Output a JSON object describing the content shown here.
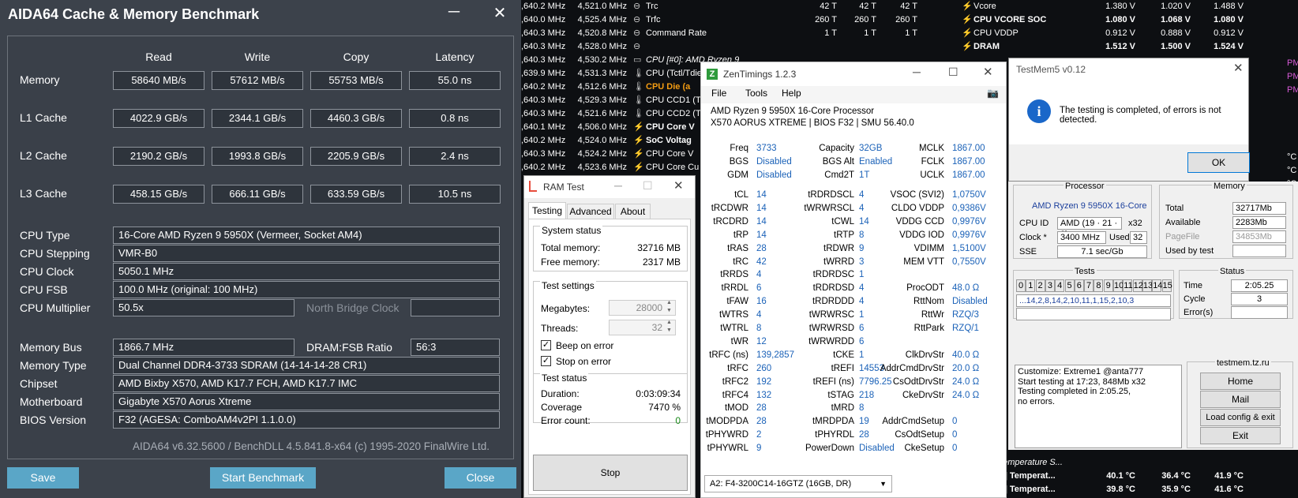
{
  "aida": {
    "title": "AIDA64 Cache & Memory Benchmark",
    "minimize": "─",
    "close": "✕",
    "headers": [
      "Read",
      "Write",
      "Copy",
      "Latency"
    ],
    "bench_rows": [
      {
        "label": "Memory",
        "read": "58640 MB/s",
        "write": "57612 MB/s",
        "copy": "55753 MB/s",
        "latency": "55.0 ns"
      },
      {
        "label": "L1 Cache",
        "read": "4022.9 GB/s",
        "write": "2344.1 GB/s",
        "copy": "4460.3 GB/s",
        "latency": "0.8 ns"
      },
      {
        "label": "L2 Cache",
        "read": "2190.2 GB/s",
        "write": "1993.8 GB/s",
        "copy": "2205.9 GB/s",
        "latency": "2.4 ns"
      },
      {
        "label": "L3 Cache",
        "read": "458.15 GB/s",
        "write": "666.11 GB/s",
        "copy": "633.59 GB/s",
        "latency": "10.5 ns"
      }
    ],
    "cpu_type_label": "CPU Type",
    "cpu_type": "16-Core AMD Ryzen 9 5950X  (Vermeer, Socket AM4)",
    "cpu_stepping_label": "CPU Stepping",
    "cpu_stepping": "VMR-B0",
    "cpu_clock_label": "CPU Clock",
    "cpu_clock": "5050.1 MHz",
    "cpu_fsb_label": "CPU FSB",
    "cpu_fsb": "100.0 MHz  (original: 100 MHz)",
    "cpu_mult_label": "CPU Multiplier",
    "cpu_mult": "50.5x",
    "nb_clock_label": "North Bridge Clock",
    "nb_clock": "",
    "mem_bus_label": "Memory Bus",
    "mem_bus": "1866.7 MHz",
    "dram_ratio_label": "DRAM:FSB Ratio",
    "dram_ratio": "56:3",
    "mem_type_label": "Memory Type",
    "mem_type": "Dual Channel DDR4-3733 SDRAM  (14-14-14-28 CR1)",
    "chipset_label": "Chipset",
    "chipset": "AMD Bixby X570, AMD K17.7 FCH, AMD K17.7 IMC",
    "mobo_label": "Motherboard",
    "mobo": "Gigabyte X570 Aorus Xtreme",
    "bios_label": "BIOS Version",
    "bios": "F32  (AGESA: ComboAM4v2PI 1.1.0.0)",
    "footer": "AIDA64 v6.32.5600 / BenchDLL 4.5.841.8-x64  (c) 1995-2020 FinalWire Ltd.",
    "save": "Save",
    "start": "Start Benchmark",
    "close_btn": "Close"
  },
  "hw_left": [
    ",640.2 MHz",
    "4,521.0 MHz",
    ",640.0 MHz",
    "4,525.4 MHz",
    ",640.3 MHz",
    "4,520.8 MHz",
    ",640.3 MHz",
    "4,528.0 MHz",
    ",640.3 MHz",
    "4,530.2 MHz",
    ",639.9 MHz",
    "4,531.3 MHz",
    ",640.2 MHz",
    "4,512.6 MHz",
    ",640.3 MHz",
    "4,529.3 MHz",
    ",640.3 MHz",
    "4,521.6 MHz",
    ",640.1 MHz",
    "4,506.0 MHz",
    ",640.2 MHz",
    "4,524.0 MHz",
    ",640.3 MHz",
    "4,524.2 MHz",
    ",640.2 MHz",
    "4,523.6 MHz"
  ],
  "hw_mid": [
    {
      "name": "Trc",
      "a": "42 T",
      "b": "42 T",
      "c": "42 T"
    },
    {
      "name": "Trfc",
      "a": "260 T",
      "b": "260 T",
      "c": "260 T"
    },
    {
      "name": "Command Rate",
      "a": "1 T",
      "b": "1 T",
      "c": "1 T"
    },
    {
      "name": "",
      "a": "",
      "b": "",
      "c": ""
    },
    {
      "name": "CPU [#0]: AMD Ryzen 9",
      "a": "",
      "b": "",
      "c": ""
    },
    {
      "name": "CPU (Tctl/Tdie)",
      "a": "",
      "b": "",
      "c": ""
    },
    {
      "name": "CPU Die (a",
      "a": "",
      "b": "",
      "c": ""
    },
    {
      "name": "CPU CCD1 (T",
      "a": "",
      "b": "",
      "c": ""
    },
    {
      "name": "CPU CCD2 (T",
      "a": "",
      "b": "",
      "c": ""
    },
    {
      "name": "CPU Core V",
      "a": "",
      "b": "",
      "c": ""
    },
    {
      "name": "SoC Voltag",
      "a": "",
      "b": "",
      "c": ""
    },
    {
      "name": "CPU Core V",
      "a": "",
      "b": "",
      "c": ""
    },
    {
      "name": "CPU Core Cu",
      "a": "",
      "b": "",
      "c": ""
    }
  ],
  "hw_right": [
    {
      "name": "Vcore",
      "a": "1.380 V",
      "b": "1.020 V",
      "c": "1.488 V",
      "bold": false
    },
    {
      "name": "CPU VCORE SOC",
      "a": "1.080 V",
      "b": "1.068 V",
      "c": "1.080 V",
      "bold": true
    },
    {
      "name": "CPU VDDP",
      "a": "0.912 V",
      "b": "0.888 V",
      "c": "0.912 V",
      "bold": false
    },
    {
      "name": "DRAM",
      "a": "1.512 V",
      "b": "1.500 V",
      "c": "1.524 V",
      "bold": true
    }
  ],
  "hw_right_edge": [
    "PM",
    "PM",
    "PM",
    "",
    "",
    "",
    "",
    "°C",
    "°C",
    "°C"
  ],
  "hw_dimm": {
    "header": "DIMM Temperature S...",
    "rows": [
      {
        "name": "DIMM[2] Temperat...",
        "a": "40.1 °C",
        "b": "36.4 °C",
        "c": "41.9 °C"
      },
      {
        "name": "DIMM[3] Temperat...",
        "a": "39.8 °C",
        "b": "35.9 °C",
        "c": "41.6 °C"
      }
    ]
  },
  "zen": {
    "title": "ZenTimings 1.2.3",
    "menu": [
      "File",
      "Tools",
      "Help"
    ],
    "cpu": "AMD Ryzen 9 5950X 16-Core Processor",
    "board": "X570 AORUS XTREME | BIOS F32 | SMU 56.40.0",
    "top": [
      {
        "l1": "Freq",
        "v1": "3733",
        "l2": "Capacity",
        "v2": "32GB",
        "l3": "MCLK",
        "v3": "1867.00"
      },
      {
        "l1": "BGS",
        "v1": "Disabled",
        "l2": "BGS Alt",
        "v2": "Enabled",
        "l3": "FCLK",
        "v3": "1867.00"
      },
      {
        "l1": "GDM",
        "v1": "Disabled",
        "l2": "Cmd2T",
        "v2": "1T",
        "l3": "UCLK",
        "v3": "1867.00"
      }
    ],
    "rows": [
      {
        "l1": "tCL",
        "v1": "14",
        "l2": "tRDRDSCL",
        "v2": "4",
        "l3": "VSOC (SVI2)",
        "v3": "1,0750V"
      },
      {
        "l1": "tRCDWR",
        "v1": "14",
        "l2": "tWRWRSCL",
        "v2": "4",
        "l3": "CLDO VDDP",
        "v3": "0,9386V"
      },
      {
        "l1": "tRCDRD",
        "v1": "14",
        "l2": "tCWL",
        "v2": "14",
        "l3": "VDDG CCD",
        "v3": "0,9976V"
      },
      {
        "l1": "tRP",
        "v1": "14",
        "l2": "tRTP",
        "v2": "8",
        "l3": "VDDG IOD",
        "v3": "0,9976V"
      },
      {
        "l1": "tRAS",
        "v1": "28",
        "l2": "tRDWR",
        "v2": "9",
        "l3": "VDIMM",
        "v3": "1,5100V"
      },
      {
        "l1": "tRC",
        "v1": "42",
        "l2": "tWRRD",
        "v2": "3",
        "l3": "MEM VTT",
        "v3": "0,7550V"
      },
      {
        "l1": "tRRDS",
        "v1": "4",
        "l2": "tRDRDSC",
        "v2": "1",
        "l3": "",
        "v3": ""
      },
      {
        "l1": "tRRDL",
        "v1": "6",
        "l2": "tRDRDSD",
        "v2": "4",
        "l3": "ProcODT",
        "v3": "48.0 Ω"
      },
      {
        "l1": "tFAW",
        "v1": "16",
        "l2": "tRDRDDD",
        "v2": "4",
        "l3": "RttNom",
        "v3": "Disabled"
      },
      {
        "l1": "tWTRS",
        "v1": "4",
        "l2": "tWRWRSC",
        "v2": "1",
        "l3": "RttWr",
        "v3": "RZQ/3"
      },
      {
        "l1": "tWTRL",
        "v1": "8",
        "l2": "tWRWRSD",
        "v2": "6",
        "l3": "RttPark",
        "v3": "RZQ/1"
      },
      {
        "l1": "tWR",
        "v1": "12",
        "l2": "tWRWRDD",
        "v2": "6",
        "l3": "",
        "v3": ""
      },
      {
        "l1": "tRFC (ns)",
        "v1": "139,2857",
        "l2": "tCKE",
        "v2": "1",
        "l3": "ClkDrvStr",
        "v3": "40.0 Ω"
      },
      {
        "l1": "tRFC",
        "v1": "260",
        "l2": "tREFI",
        "v2": "14553",
        "l3": "AddrCmdDrvStr",
        "v3": "20.0 Ω"
      },
      {
        "l1": "tRFC2",
        "v1": "192",
        "l2": "tREFI (ns)",
        "v2": "7796.25",
        "l3": "CsOdtDrvStr",
        "v3": "24.0 Ω"
      },
      {
        "l1": "tRFC4",
        "v1": "132",
        "l2": "tSTAG",
        "v2": "218",
        "l3": "CkeDrvStr",
        "v3": "24.0 Ω"
      },
      {
        "l1": "tMOD",
        "v1": "28",
        "l2": "tMRD",
        "v2": "8",
        "l3": "",
        "v3": ""
      },
      {
        "l1": "tMODPDA",
        "v1": "28",
        "l2": "tMRDPDA",
        "v2": "19",
        "l3": "AddrCmdSetup",
        "v3": "0"
      },
      {
        "l1": "tPHYWRD",
        "v1": "2",
        "l2": "tPHYRDL",
        "v2": "28",
        "l3": "CsOdtSetup",
        "v3": "0"
      },
      {
        "l1": "tPHYWRL",
        "v1": "9",
        "l2": "PowerDown",
        "v2": "Disabled",
        "l3": "CkeSetup",
        "v3": "0"
      }
    ],
    "dimm_select": "A2: F4-3200C14-16GTZ (16GB, DR)"
  },
  "ram": {
    "title": "RAM Test",
    "tabs": [
      "Testing",
      "Advanced",
      "About"
    ],
    "sys_status": "System status",
    "total_mem_label": "Total memory:",
    "total_mem": "32716 MB",
    "free_mem_label": "Free memory:",
    "free_mem": "2317 MB",
    "test_settings": "Test settings",
    "megabytes_label": "Megabytes:",
    "megabytes": "28000",
    "threads_label": "Threads:",
    "threads": "32",
    "beep": "Beep on error",
    "stop_on": "Stop on error",
    "test_status": "Test status",
    "duration_label": "Duration:",
    "duration": "0:03:09:34",
    "coverage_label": "Coverage",
    "coverage": "7470 %",
    "errors_label": "Error count:",
    "errors": "0",
    "stop": "Stop"
  },
  "tm5dlg": {
    "title": "TestMem5 v0.12",
    "message": "The testing is completed, of errors is not detected.",
    "ok": "OK"
  },
  "tm5": {
    "processor": "Processor",
    "memory": "Memory",
    "cpu_name": "AMD Ryzen 9 5950X 16-Core",
    "cpuid_label": "CPU ID",
    "cpuid": "AMD  (19 · 21 · 0)",
    "cpuid_x": "x32",
    "clock_label": "Clock *",
    "clock": "3400 MHz",
    "used_label": "Used",
    "used": "32",
    "sse_label": "SSE",
    "sse": "7.1 sec/Gb",
    "total_label": "Total",
    "total": "32717Mb",
    "avail_label": "Available",
    "avail": "2283Mb",
    "pagefile_label": "PageFile",
    "pagefile": "34853Mb",
    "usedby_label": "Used by test",
    "usedby": "",
    "tests_label": "Tests",
    "status_label": "Status",
    "test_cells": [
      "0",
      "1",
      "2",
      "3",
      "4",
      "5",
      "6",
      "7",
      "8",
      "9",
      "10",
      "11",
      "12",
      "13",
      "14",
      "15"
    ],
    "sequence": "...14,2,8,14,2,10,11,1,15,2,10,3",
    "time_label": "Time",
    "time": "2:05.25",
    "cycle_label": "Cycle",
    "cycle": "3",
    "errs_label": "Error(s)",
    "errs": "",
    "log": [
      "Customize: Extreme1 @anta777",
      "Start testing at 17:23, 848Mb x32",
      "Testing completed in 2:05.25,",
      "no errors."
    ],
    "site": "testmem.tz.ru",
    "buttons": [
      "Home",
      "Mail",
      "Load config & exit",
      "Exit"
    ]
  }
}
